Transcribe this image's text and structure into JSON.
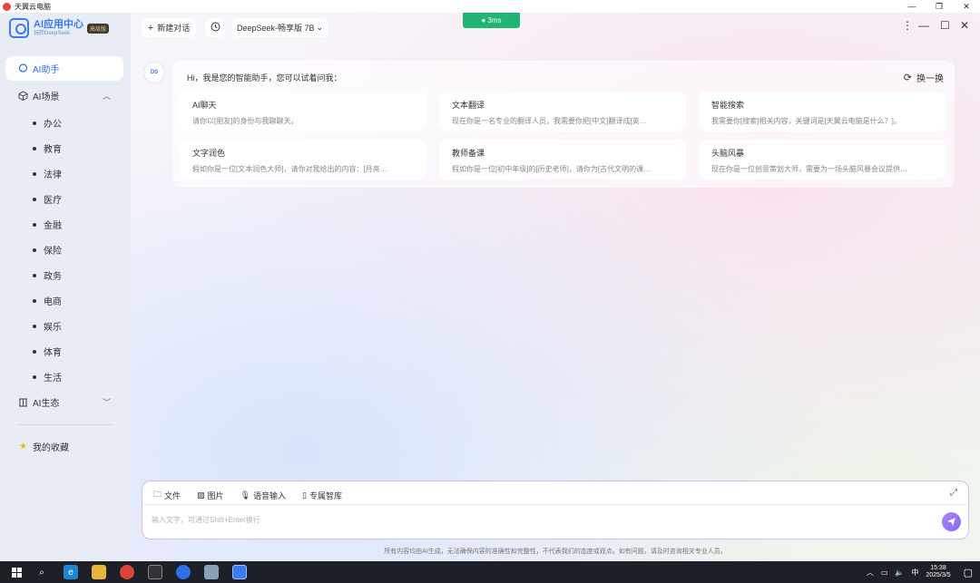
{
  "window": {
    "title": "天翼云电脑",
    "controls": [
      "—",
      "❐",
      "✕"
    ]
  },
  "logo": {
    "title": "AI应用中心",
    "subtitle": "玩转DeepSeek",
    "badge": "高级版"
  },
  "sidebar": {
    "items": [
      {
        "label": "AI助手",
        "icon": "chat-bubble-icon",
        "active": true
      },
      {
        "label": "AI场景",
        "icon": "cube-icon",
        "expanded": true
      },
      {
        "label": "AI生态",
        "icon": "columns-icon",
        "expanded": false
      },
      {
        "label": "我的收藏",
        "icon": "star-icon"
      }
    ],
    "scenes": [
      "办公",
      "教育",
      "法律",
      "医疗",
      "金融",
      "保险",
      "政务",
      "电商",
      "娱乐",
      "体育",
      "生活"
    ]
  },
  "toolbar": {
    "new_chat": "新建对话",
    "model": "DeepSeek-畅享版 7B",
    "ping": "3ms"
  },
  "assistant": {
    "greeting": "Hi，我是您的智能助手，您可以试着问我：",
    "refresh_label": "换一换",
    "cards": [
      {
        "title": "AI聊天",
        "desc": "请你以[朋友]的身份与我聊聊天。"
      },
      {
        "title": "文本翻译",
        "desc": "现在你是一名专业的翻译人员，我需要你把[中文]翻译成[英…"
      },
      {
        "title": "智能搜索",
        "desc": "我需要你[搜索]相关内容，关键词是[天翼云电脑是什么？]。"
      },
      {
        "title": "文字润色",
        "desc": "假如你是一位[文本润色大师]，请你对我给出的内容：[月亮…"
      },
      {
        "title": "教师备课",
        "desc": "假如你是一位[初中年级]的[历史老师]，请你为[古代文明的课…"
      },
      {
        "title": "头脑风暴",
        "desc": "现在你是一位创意策划大师，需要为一场头脑风暴会议提供…"
      }
    ]
  },
  "input": {
    "tools": [
      "文件",
      "图片",
      "语音输入",
      "专属智库"
    ],
    "placeholder": "输入文字，可通过Shift+Enter换行",
    "disclaimer": "所有内容均由AI生成，无法确保内容的准确性和完整性，不代表我们的态度或观点。如有问题，请及时咨询相关专业人员。"
  },
  "taskbar": {
    "ime": "中",
    "time": "15:38",
    "date": "2025/3/5"
  },
  "colors": {
    "accent": "#2f6fe8",
    "ping": "#21b573",
    "send": "#8a6ef2",
    "sidebar": "#e8ecf4"
  }
}
